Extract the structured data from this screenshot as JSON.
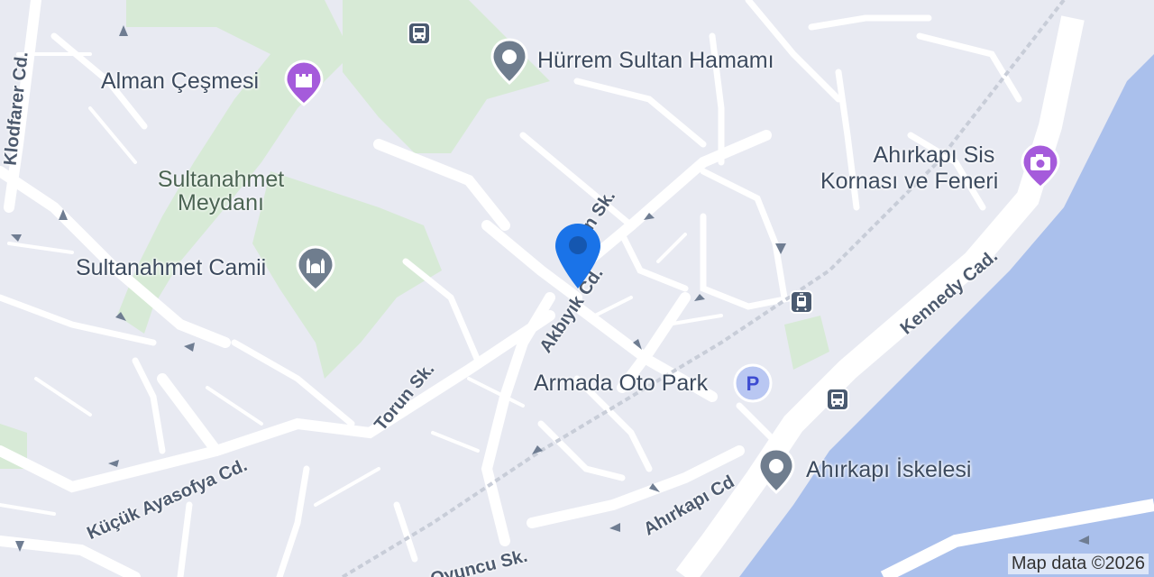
{
  "map": {
    "attribution": "Map data ©2026",
    "pois": [
      {
        "name": "Hürrem Sultan Hamamı",
        "icon": "landmark-pin-icon"
      },
      {
        "name": "Alman Çeşmesi",
        "icon": "castle-icon"
      },
      {
        "name": "Sultanahmet Camii",
        "icon": "mosque-icon"
      },
      {
        "name": "Ahırkapı Sis Kornası ve Feneri",
        "line1": "Ahırkapı Sis",
        "line2": "Kornası ve Feneri",
        "icon": "camera-icon"
      },
      {
        "name": "Armada Oto Park",
        "icon": "parking-icon"
      },
      {
        "name": "Ahırkapı İskelesi",
        "icon": "landmark-pin-icon"
      }
    ],
    "areas": [
      {
        "name": "Sultanahmet Meydanı",
        "line1": "Sultanahmet",
        "line2": "Meydanı"
      }
    ],
    "streets": [
      {
        "name": "Klodfarer Cd."
      },
      {
        "name": "Akbıyık Cd."
      },
      {
        "name": "Güngün Sk.",
        "visible": "ğün Sk."
      },
      {
        "name": "Torun Sk."
      },
      {
        "name": "Küçük Ayasofya Cd."
      },
      {
        "name": "Kennedy Cad."
      },
      {
        "name": "Ahırkapı Cd"
      },
      {
        "name": "Oyuncu Sk."
      }
    ],
    "colors": {
      "land": "#e8eaf2",
      "road": "#ffffff",
      "water": "#aac0ec",
      "park": "#d7ead6",
      "pin": "#1a73e8",
      "poi_purple": "#a55bdb",
      "transit": "#4a5a70"
    }
  }
}
